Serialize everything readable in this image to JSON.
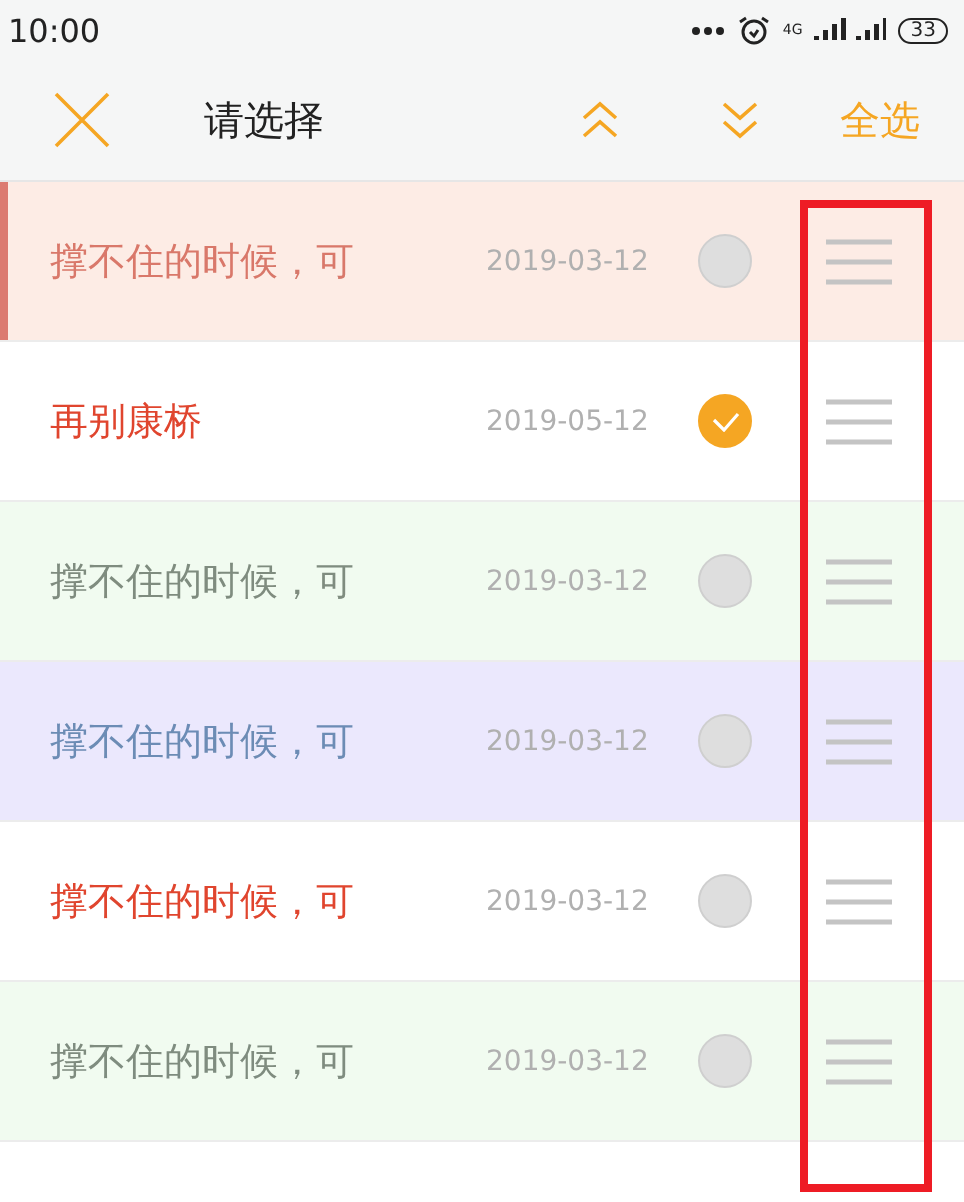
{
  "status_bar": {
    "time": "10:00",
    "network": "4G",
    "battery": "33"
  },
  "toolbar": {
    "title": "请选择",
    "select_all": "全选"
  },
  "rows": [
    {
      "title": "撑不住的时候，可",
      "date": "2019-03-12",
      "checked": false,
      "current": true,
      "color": "#fdece5"
    },
    {
      "title": "再别康桥",
      "date": "2019-05-12",
      "checked": true,
      "current": false,
      "color": "#ffffff"
    },
    {
      "title": "撑不住的时候，可",
      "date": "2019-03-12",
      "checked": false,
      "current": false,
      "color": "#f1fbf0"
    },
    {
      "title": "撑不住的时候，可",
      "date": "2019-03-12",
      "checked": false,
      "current": false,
      "color": "#ebe8fd"
    },
    {
      "title": "撑不住的时候，可",
      "date": "2019-03-12",
      "checked": false,
      "current": false,
      "color": "#ffffff"
    },
    {
      "title": "撑不住的时候，可",
      "date": "2019-03-12",
      "checked": false,
      "current": false,
      "color": "#f1fbf0"
    }
  ],
  "highlight_frame": true
}
